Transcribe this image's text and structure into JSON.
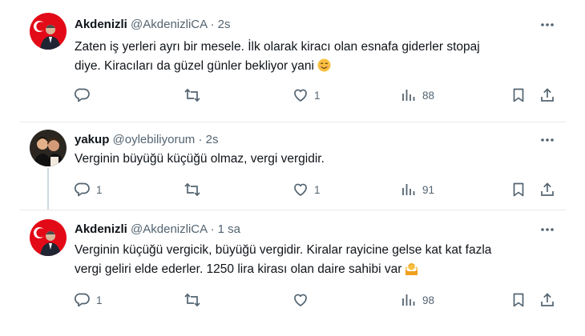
{
  "tweets": [
    {
      "name": "Akdenizli",
      "handle": "@AkdenizliCA",
      "separator": "·",
      "time": "2s",
      "avatar_icon": "flag-avatar",
      "lines": [
        "Zaten iş yerleri ayrı bir mesele. İlk olarak kiracı olan esnafa giderler stopaj",
        "diye. Kiracıları da güzel günler bekliyor yani"
      ],
      "emoji": "smiling-face-icon",
      "replies": "",
      "retweets": "",
      "likes": "1",
      "views": "88"
    },
    {
      "name": "yakup",
      "handle": "@oylebiliyorum",
      "separator": "·",
      "time": "2s",
      "avatar_icon": "photo-avatar",
      "lines": [
        "Verginin büyüğü küçüğü olmaz, vergi vergidir."
      ],
      "replies": "1",
      "retweets": "",
      "likes": "1",
      "views": "91"
    },
    {
      "name": "Akdenizli",
      "handle": "@AkdenizliCA",
      "separator": "·",
      "time": "1 sa",
      "avatar_icon": "flag-avatar",
      "lines": [
        "Verginin küçüğü vergicik, büyüğü vergidir. Kiralar rayicine gelse kat kat fazla",
        "vergi geliri elde ederler. 1250 lira kirası olan daire sahibi var"
      ],
      "emoji": "shrugging-person-icon",
      "replies": "1",
      "retweets": "",
      "likes": "",
      "views": "98"
    }
  ],
  "colors": {
    "text": "#0f1419",
    "secondary": "#536471",
    "divider": "#e6eaed",
    "thread": "#cfd9de",
    "flag_red": "#e30a17"
  }
}
